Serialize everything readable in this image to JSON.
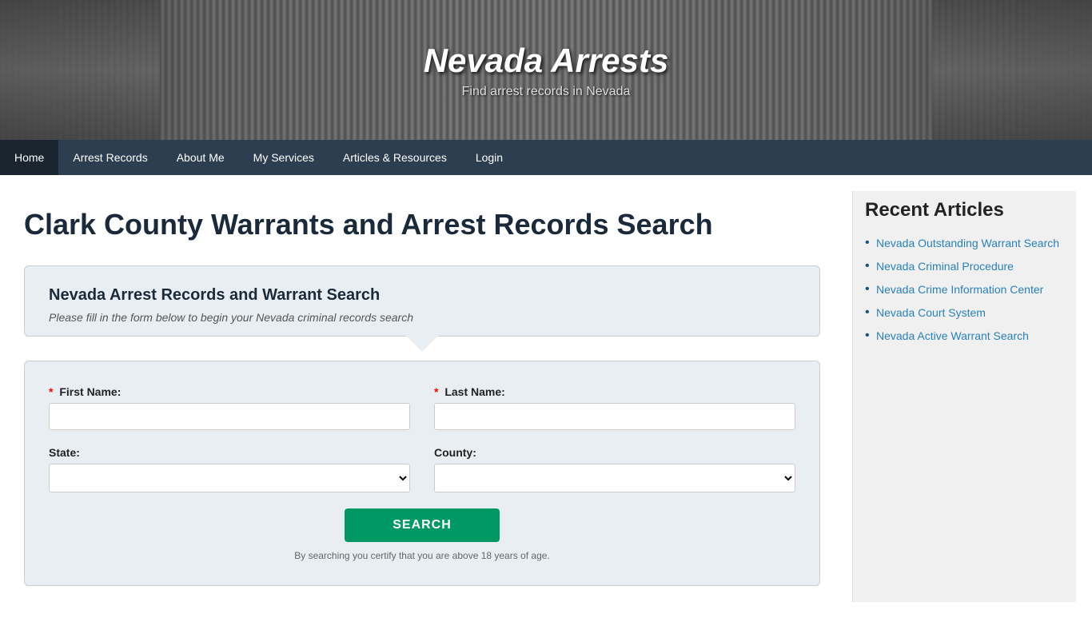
{
  "site": {
    "title": "Nevada Arrests",
    "subtitle": "Find arrest records in Nevada"
  },
  "nav": {
    "items": [
      {
        "label": "Home",
        "active": false
      },
      {
        "label": "Arrest Records",
        "active": false
      },
      {
        "label": "About Me",
        "active": false
      },
      {
        "label": "My Services",
        "active": false
      },
      {
        "label": "Articles & Resources",
        "active": false
      },
      {
        "label": "Login",
        "active": false
      }
    ]
  },
  "main": {
    "page_title": "Clark County Warrants and Arrest Records Search",
    "search_box_title": "Nevada Arrest Records and Warrant Search",
    "search_box_subtitle": "Please fill in the form below to begin your Nevada criminal records search",
    "form": {
      "first_name_label": "First Name:",
      "last_name_label": "Last Name:",
      "state_label": "State:",
      "county_label": "County:",
      "search_button": "SEARCH",
      "form_note": "By searching you certify that you are above 18 years of age."
    }
  },
  "sidebar": {
    "title": "Recent Articles",
    "links": [
      {
        "label": "Nevada Outstanding Warrant Search"
      },
      {
        "label": "Nevada Criminal Procedure"
      },
      {
        "label": "Nevada Crime Information Center"
      },
      {
        "label": "Nevada Court System"
      },
      {
        "label": "Nevada Active Warrant Search"
      }
    ]
  }
}
